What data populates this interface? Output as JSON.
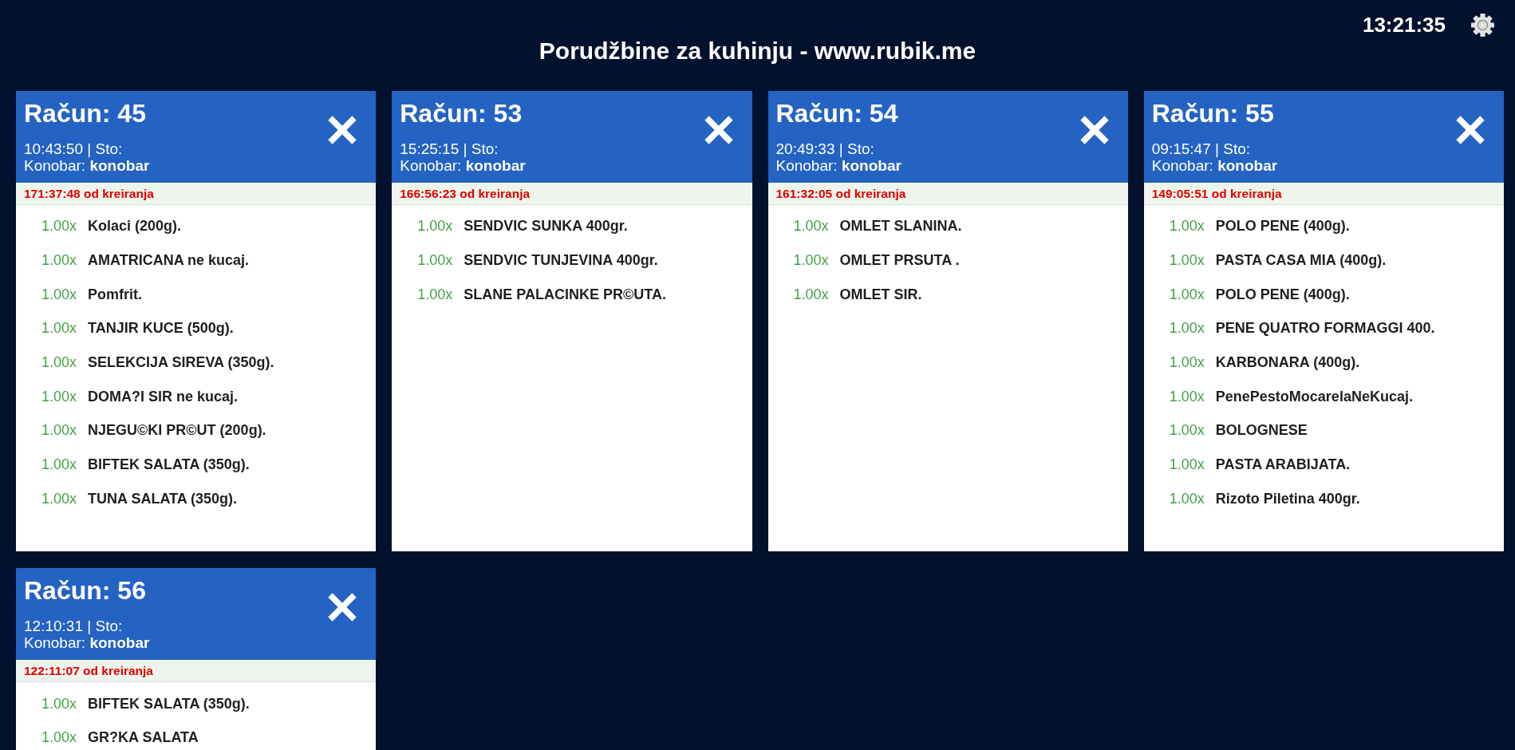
{
  "header": {
    "clock": "13:21:35",
    "title": "Porudžbine za kuhinju - www.rubik.me"
  },
  "orders": [
    {
      "title": "Račun: 45",
      "time_table": "10:43:50 | Sto:",
      "waiter": "Konobar: **konobar**",
      "elapsed": "171:37:48 od kreiranja",
      "items": [
        {
          "quantity": "1.00x",
          "name": "Kolaci (200g)."
        },
        {
          "quantity": "1.00x",
          "name": "AMATRICANA ne kucaj."
        },
        {
          "quantity": "1.00x",
          "name": "Pomfrit."
        },
        {
          "quantity": "1.00x",
          "name": "TANJIR KUCE (500g)."
        },
        {
          "quantity": "1.00x",
          "name": "SELEKCIJA SIREVA (350g)."
        },
        {
          "quantity": "1.00x",
          "name": "DOMA?I SIR ne kucaj."
        },
        {
          "quantity": "1.00x",
          "name": "NJEGU©KI PR©UT (200g)."
        },
        {
          "quantity": "1.00x",
          "name": "BIFTEK SALATA (350g)."
        },
        {
          "quantity": "1.00x",
          "name": "TUNA SALATA (350g)."
        }
      ]
    },
    {
      "title": "Račun: 53",
      "time_table": "15:25:15 | Sto:",
      "waiter": "Konobar: **konobar**",
      "elapsed": "166:56:23 od kreiranja",
      "items": [
        {
          "quantity": "1.00x",
          "name": "SENDVIC SUNKA 400gr."
        },
        {
          "quantity": "1.00x",
          "name": "SENDVIC TUNJEVINA 400gr."
        },
        {
          "quantity": "1.00x",
          "name": "SLANE PALACINKE PR©UTA."
        }
      ]
    },
    {
      "title": "Račun: 54",
      "time_table": "20:49:33 | Sto:",
      "waiter": "Konobar: **konobar**",
      "elapsed": "161:32:05 od kreiranja",
      "items": [
        {
          "quantity": "1.00x",
          "name": "OMLET SLANINA."
        },
        {
          "quantity": "1.00x",
          "name": "OMLET PRSUTA ."
        },
        {
          "quantity": "1.00x",
          "name": "OMLET SIR."
        }
      ]
    },
    {
      "title": "Račun: 55",
      "time_table": "09:15:47 | Sto:",
      "waiter": "Konobar: **konobar**",
      "elapsed": "149:05:51 od kreiranja",
      "items": [
        {
          "quantity": "1.00x",
          "name": "POLO PENE (400g)."
        },
        {
          "quantity": "1.00x",
          "name": "PASTA CASA MIA (400g)."
        },
        {
          "quantity": "1.00x",
          "name": "POLO PENE (400g)."
        },
        {
          "quantity": "1.00x",
          "name": "PENE QUATRO FORMAGGI 400."
        },
        {
          "quantity": "1.00x",
          "name": "KARBONARA (400g)."
        },
        {
          "quantity": "1.00x",
          "name": "PenePestoMocarelaNeKucaj."
        },
        {
          "quantity": "1.00x",
          "name": "BOLOGNESE"
        },
        {
          "quantity": "1.00x",
          "name": "PASTA ARABIJATA."
        },
        {
          "quantity": "1.00x",
          "name": "Rizoto Piletina 400gr."
        }
      ]
    },
    {
      "title": "Račun: 56",
      "time_table": "12:10:31 | Sto:",
      "waiter": "Konobar: **konobar**",
      "elapsed": "122:11:07 od kreiranja",
      "items": [
        {
          "quantity": "1.00x",
          "name": "BIFTEK SALATA (350g)."
        },
        {
          "quantity": "1.00x",
          "name": "GR?KA SALATA"
        }
      ]
    }
  ]
}
